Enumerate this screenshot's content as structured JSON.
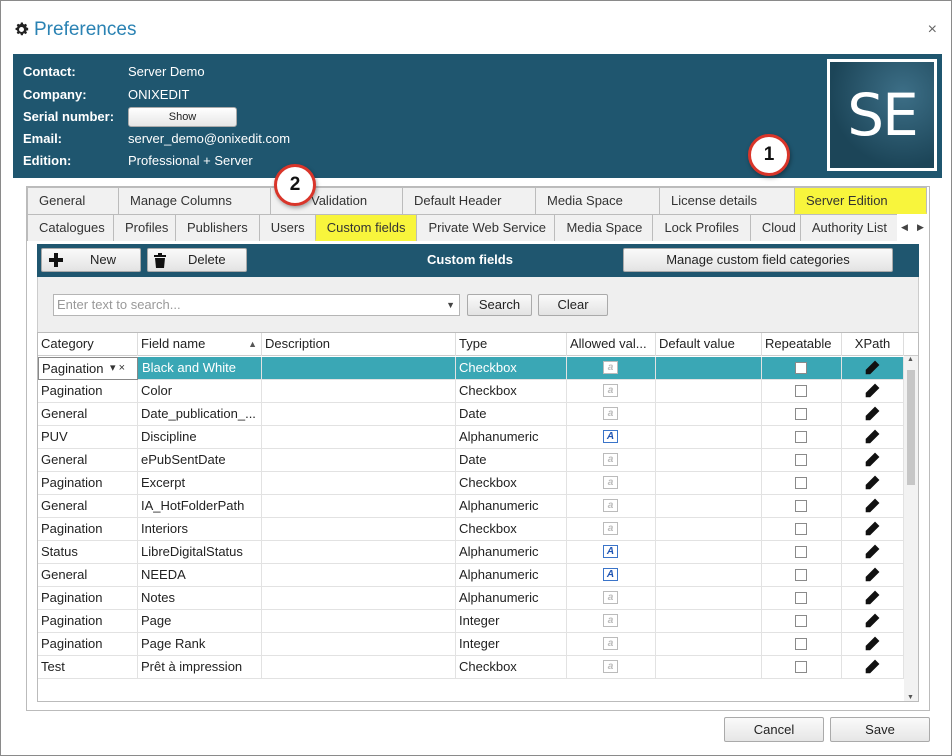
{
  "window": {
    "title": "Preferences",
    "close": "×"
  },
  "header": {
    "contact_label": "Contact:",
    "contact_value": "Server Demo",
    "company_label": "Company:",
    "company_value": "ONIXEDIT",
    "serial_label": "Serial number:",
    "show_button": "Show",
    "email_label": "Email:",
    "email_value": "server_demo@onixedit.com",
    "edition_label": "Edition:",
    "edition_value": "Professional + Server",
    "logo_text": "SE"
  },
  "tabs_top": [
    "General",
    "Manage Columns",
    "Validation",
    "Default Header",
    "Media Space",
    "License details",
    "Server Edition"
  ],
  "tabs_sub": [
    "Catalogues",
    "Profiles",
    "Publishers",
    "Users",
    "Custom fields",
    "Private Web Service",
    "Media Space",
    "Lock Profiles",
    "Cloud",
    "Authority List"
  ],
  "toolbar": {
    "new_label": "New",
    "delete_label": "Delete",
    "title": "Custom fields",
    "manage_label": "Manage custom field categories"
  },
  "search": {
    "placeholder": "Enter text to search...",
    "search_label": "Search",
    "clear_label": "Clear"
  },
  "columns": [
    "Category",
    "Field name",
    "Description",
    "Type",
    "Allowed val...",
    "Default value",
    "Repeatable",
    "XPath"
  ],
  "rows": [
    {
      "category": "Pagination",
      "field": "Black and White",
      "type": "Checkbox",
      "allowed": "a"
    },
    {
      "category": "Pagination",
      "field": "Color",
      "type": "Checkbox",
      "allowed": "a"
    },
    {
      "category": "General",
      "field": "Date_publication_...",
      "type": "Date",
      "allowed": "a"
    },
    {
      "category": "PUV",
      "field": "Discipline",
      "type": "Alphanumeric",
      "allowed": "A"
    },
    {
      "category": "General",
      "field": "ePubSentDate",
      "type": "Date",
      "allowed": "a"
    },
    {
      "category": "Pagination",
      "field": "Excerpt",
      "type": "Checkbox",
      "allowed": "a"
    },
    {
      "category": "General",
      "field": "IA_HotFolderPath",
      "type": "Alphanumeric",
      "allowed": "a"
    },
    {
      "category": "Pagination",
      "field": "Interiors",
      "type": "Checkbox",
      "allowed": "a"
    },
    {
      "category": "Status",
      "field": "LibreDigitalStatus",
      "type": "Alphanumeric",
      "allowed": "A"
    },
    {
      "category": "General",
      "field": "NEEDA",
      "type": "Alphanumeric",
      "allowed": "A"
    },
    {
      "category": "Pagination",
      "field": "Notes",
      "type": "Alphanumeric",
      "allowed": "a"
    },
    {
      "category": "Pagination",
      "field": "Page",
      "type": "Integer",
      "allowed": "a"
    },
    {
      "category": "Pagination",
      "field": "Page Rank",
      "type": "Integer",
      "allowed": "a"
    },
    {
      "category": "Test",
      "field": "Prêt à impression",
      "type": "Checkbox",
      "allowed": "a"
    }
  ],
  "footer": {
    "cancel_label": "Cancel",
    "save_label": "Save"
  },
  "callouts": {
    "one": "1",
    "two": "2"
  },
  "colors": {
    "accent": "#1f566f",
    "selection": "#3aa7b5",
    "highlight": "#f8f53c",
    "callout_border": "#d9352a"
  }
}
